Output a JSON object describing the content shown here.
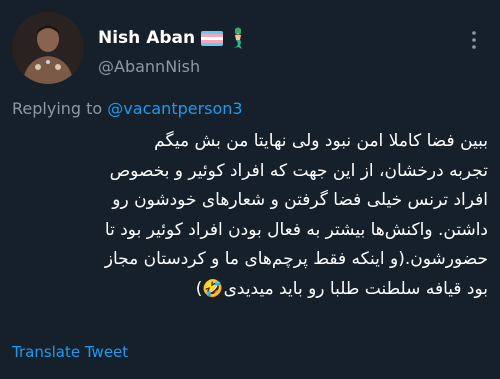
{
  "author": {
    "display_name": "Nish Aban",
    "username": "@AbannNish",
    "name_badges": [
      "transgender-flag-icon",
      "merperson-icon"
    ]
  },
  "reply": {
    "prefix": "Replying to",
    "handle": "@vacantperson3"
  },
  "tweet": {
    "lines": [
      "ببین فضا کاملا امن نبود ولی نهایتا من بش میگم",
      "تجربه درخشان، از این جهت که افراد کوئیر و بخصوص",
      "افراد ترنس خیلی فضا گرفتن و شعارهای خودشون رو",
      "داشتن. واکنش‌ها بیشتر به فعال بودن افراد کوئیر بود تا",
      "حضورشون.(و اینکه فقط پرچم‌های ما و کردستان مجاز",
      "بود قیافه سلطنت طلبا رو باید میدیدی🤣)"
    ]
  },
  "actions": {
    "translate_label": "Translate Tweet",
    "more_icon": "more-dots-icon"
  },
  "colors": {
    "background": "#15202b",
    "text_primary": "#ffffff",
    "text_secondary": "#8b98a5",
    "link": "#1d9bf0"
  }
}
